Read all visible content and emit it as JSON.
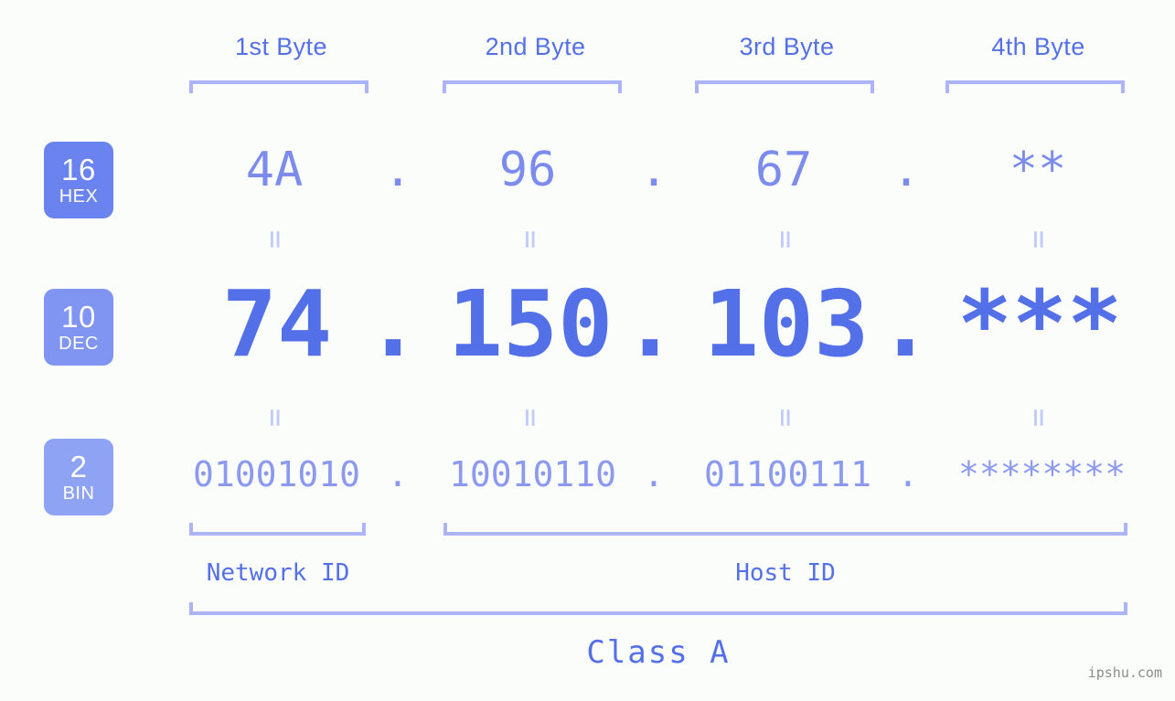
{
  "colors": {
    "background": "#fbfdfa",
    "accent_dec": "#5470e8",
    "accent_hex": "#7b8ced",
    "accent_bin": "#8b99ef",
    "bracket": "#aab4f7",
    "equals": "#c2cafa",
    "badge_hex": "#6b83ef",
    "badge_dec": "#8094f2",
    "badge_bin": "#8fa3f5",
    "watermark": "#8c8c8c"
  },
  "headers": [
    {
      "label": "1st Byte"
    },
    {
      "label": "2nd Byte"
    },
    {
      "label": "3rd Byte"
    },
    {
      "label": "4th Byte"
    }
  ],
  "badges": [
    {
      "num": "16",
      "label": "HEX"
    },
    {
      "num": "10",
      "label": "DEC"
    },
    {
      "num": "2",
      "label": "BIN"
    }
  ],
  "rows": {
    "hex": {
      "values": [
        "4A",
        "96",
        "67",
        "**"
      ],
      "separator": "."
    },
    "dec": {
      "values": [
        "74",
        "150",
        "103",
        "***"
      ],
      "separator": "."
    },
    "bin": {
      "values": [
        "01001010",
        "10010110",
        "01100111",
        "********"
      ],
      "separator": "."
    }
  },
  "equals_symbol": "=",
  "captions": {
    "network_id": "Network ID",
    "host_id": "Host ID",
    "class": "Class A"
  },
  "watermark": "ipshu.com"
}
